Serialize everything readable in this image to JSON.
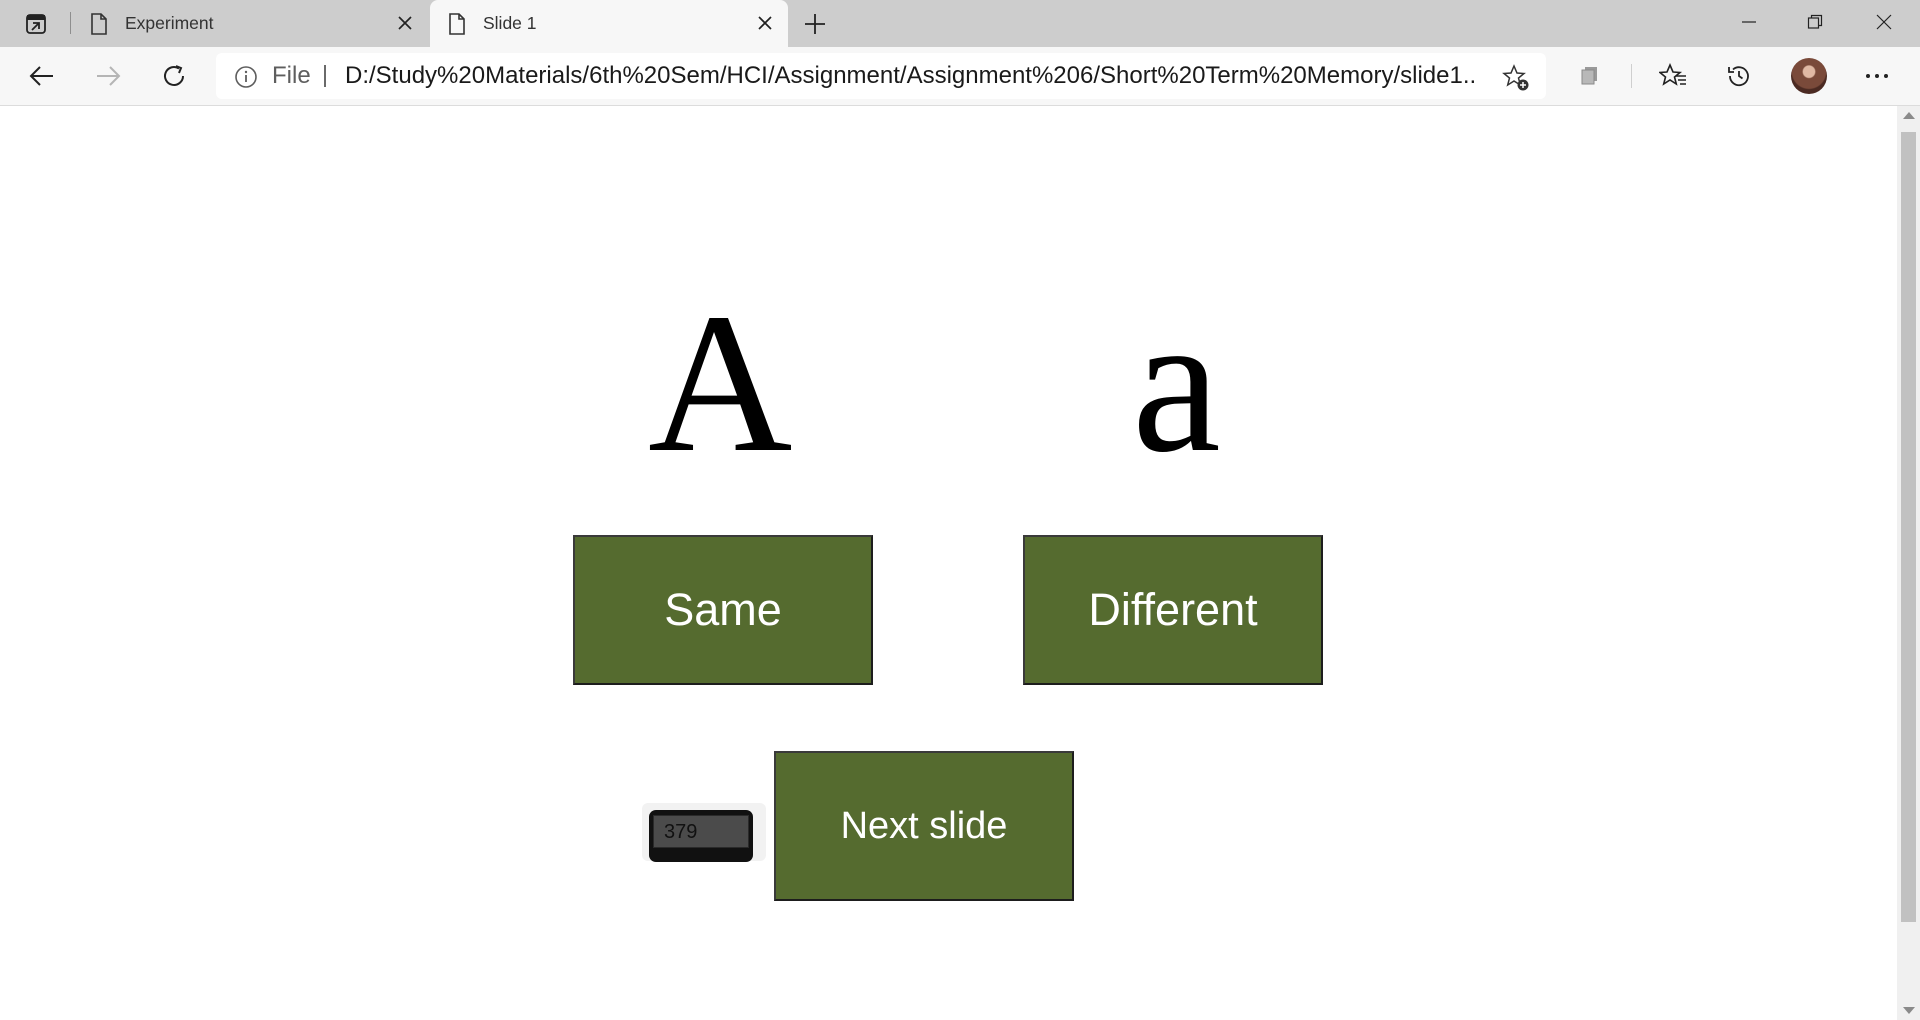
{
  "browser": {
    "tabs": [
      {
        "title": "Experiment",
        "active": false
      },
      {
        "title": "Slide 1",
        "active": true
      }
    ],
    "address_bar": {
      "scheme_label": "File",
      "url": "D:/Study%20Materials/6th%20Sem/HCI/Assignment/Assignment%206/Short%20Term%20Memory/slide1...."
    },
    "icons": {
      "tab_actions": "tab-actions-icon",
      "page": "page-icon",
      "close": "close-icon",
      "new_tab": "plus-icon",
      "minimize": "minimize-icon",
      "restore": "restore-icon",
      "window_close": "window-close-icon",
      "back": "back-arrow-icon",
      "forward": "forward-arrow-icon",
      "refresh": "refresh-icon",
      "info": "info-icon",
      "add_favorite": "star-plus-icon",
      "collections": "collections-icon",
      "favorites": "favorites-icon",
      "history": "history-icon",
      "profile": "avatar",
      "menu": "more-icon"
    }
  },
  "slide": {
    "left_letter": "A",
    "right_letter": "a",
    "same_label": "Same",
    "different_label": "Different",
    "next_label": "Next slide",
    "timer_value": "379"
  },
  "colors": {
    "button_green": "#556b2f",
    "tabstrip": "#cdcdcd",
    "toolbar": "#f7f7f7"
  }
}
